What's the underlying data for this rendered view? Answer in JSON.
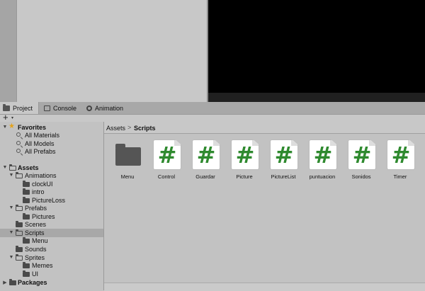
{
  "tabs": [
    {
      "label": "Project",
      "icon": "folder-icon",
      "active": true
    },
    {
      "label": "Console",
      "icon": "console-icon",
      "active": false
    },
    {
      "label": "Animation",
      "icon": "animation-icon",
      "active": false
    }
  ],
  "toolbar": {
    "add_label": "+",
    "add_caret": "▾"
  },
  "tree": {
    "favorites": {
      "label": "Favorites",
      "items": [
        "All Materials",
        "All Models",
        "All Prefabs"
      ]
    },
    "assets": {
      "label": "Assets",
      "animations": {
        "label": "Animations",
        "children": [
          "clockUI",
          "intro",
          "PictureLoss"
        ]
      },
      "prefabs": {
        "label": "Prefabs",
        "children": [
          "Pictures"
        ]
      },
      "scenes": "Scenes",
      "scripts": {
        "label": "Scripts",
        "children": [
          "Menu"
        ]
      },
      "sounds": "Sounds",
      "sprites": {
        "label": "Sprites",
        "children": [
          "Memes",
          "UI"
        ]
      }
    },
    "packages": "Packages"
  },
  "breadcrumb": {
    "root": "Assets",
    "separator": ">",
    "current": "Scripts"
  },
  "assets_grid": [
    {
      "name": "Menu",
      "type": "folder"
    },
    {
      "name": "Control",
      "type": "script"
    },
    {
      "name": "Guardar",
      "type": "script"
    },
    {
      "name": "Picture",
      "type": "script"
    },
    {
      "name": "PictureList",
      "type": "script"
    },
    {
      "name": "puntuacion",
      "type": "script"
    },
    {
      "name": "Sonidos",
      "type": "script"
    },
    {
      "name": "Timer",
      "type": "script"
    }
  ],
  "script_glyph": "#",
  "colors": {
    "script_hash": "#2f8a2f",
    "favorites_star": "#e3a21a",
    "game_view": "#000000"
  }
}
